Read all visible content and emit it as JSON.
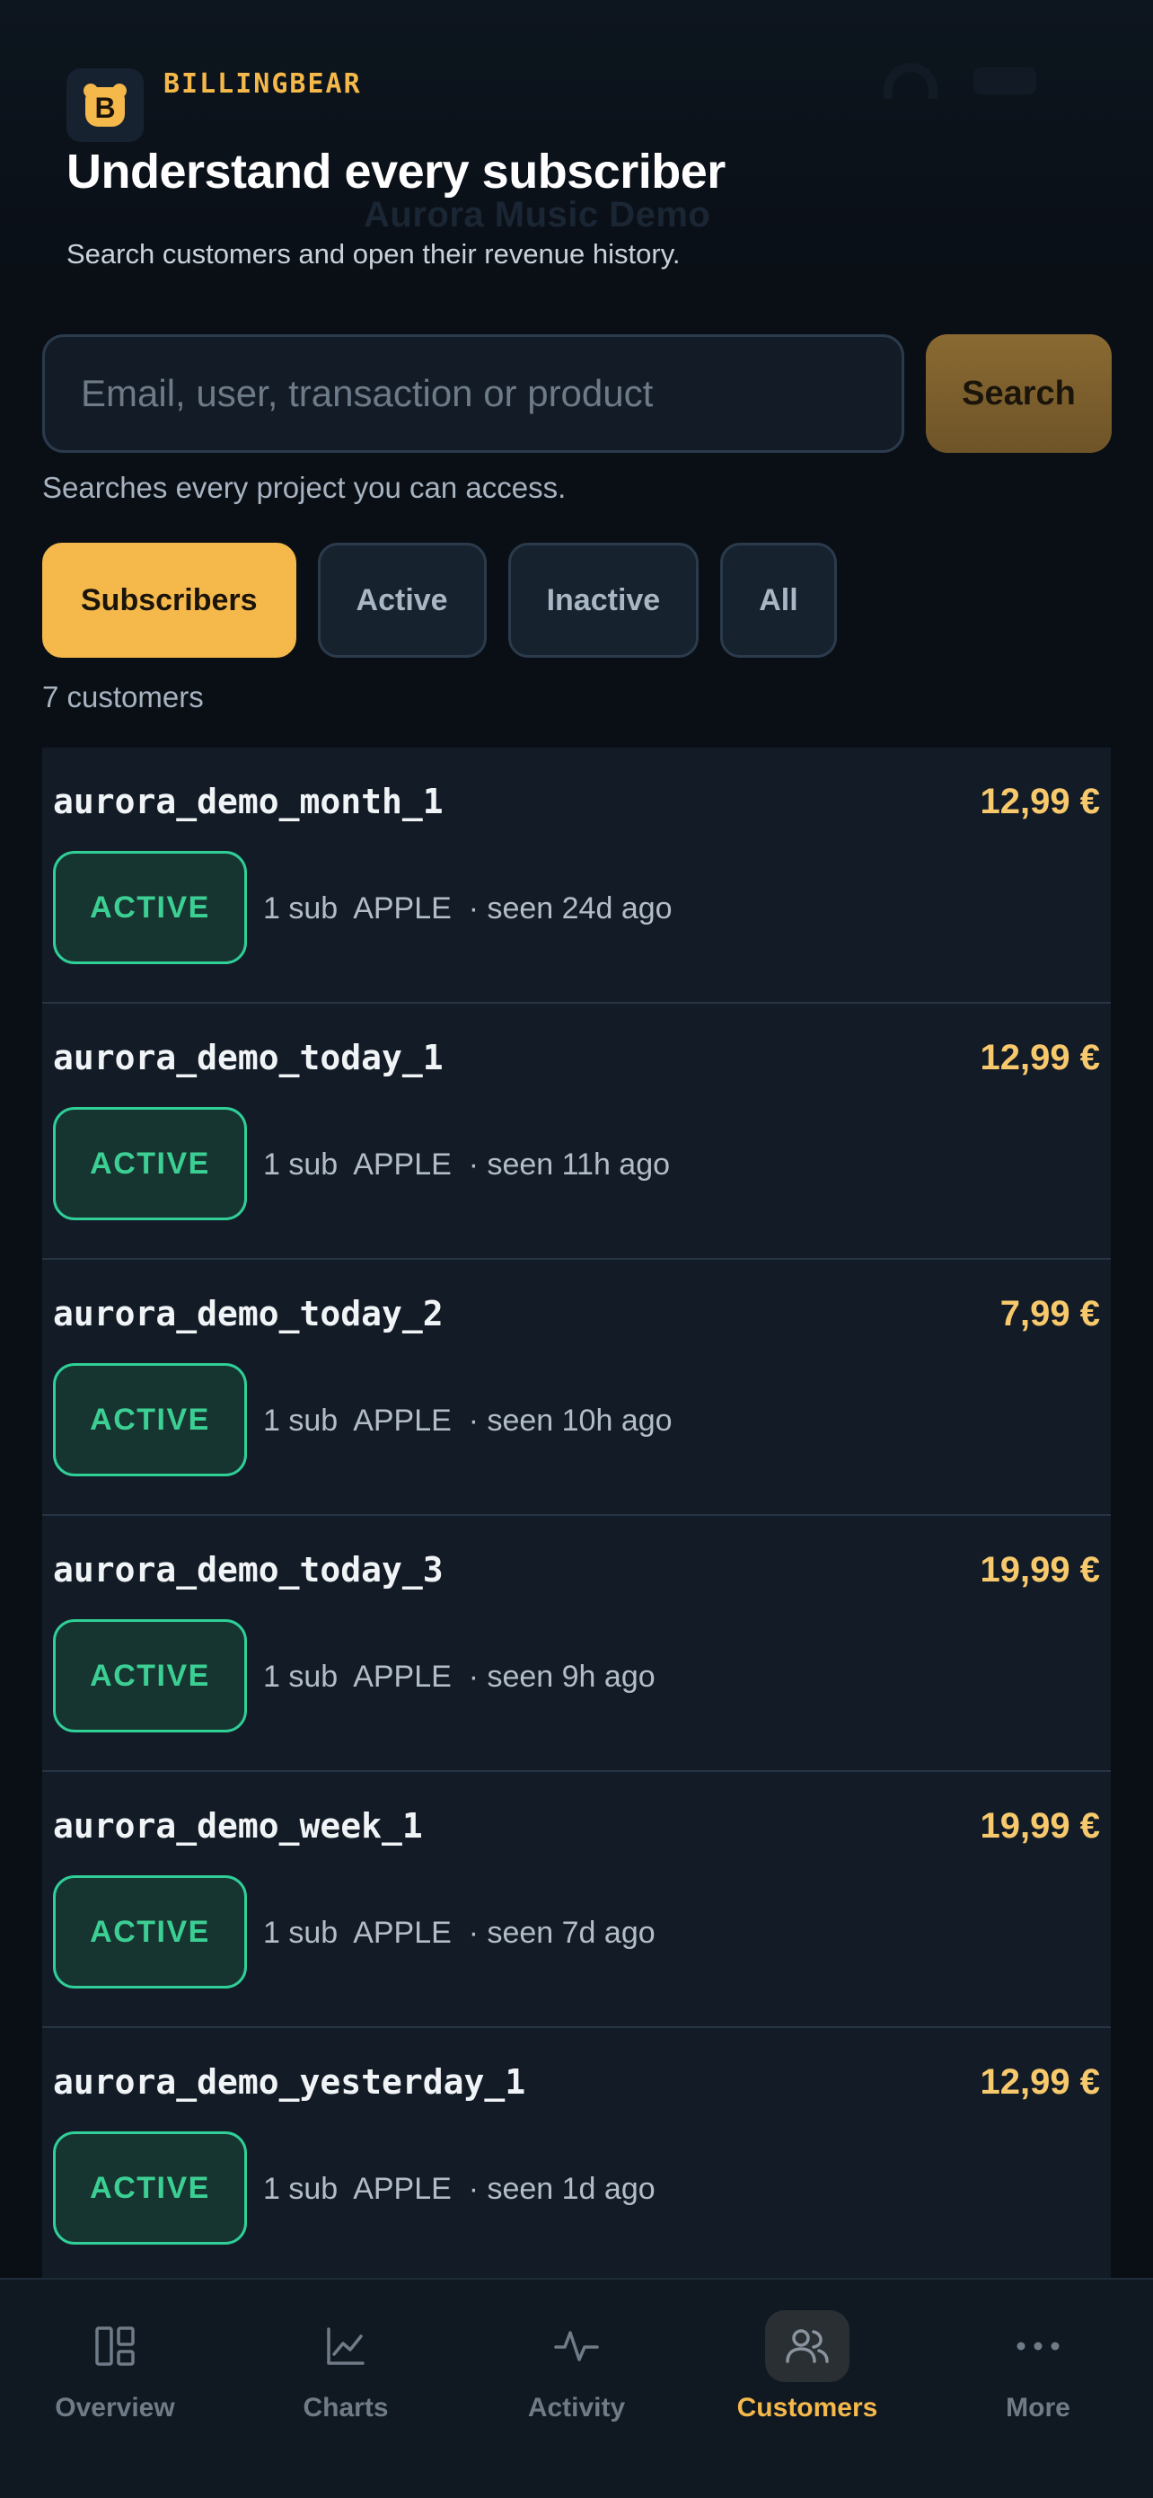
{
  "app": {
    "brand": "BILLINGBEAR",
    "faint_project": "Aurora Music Demo",
    "headline": "Understand every subscriber",
    "subhead": "Search customers and open their revenue history."
  },
  "search": {
    "placeholder": "Email, user, transaction or product",
    "button_label": "Search",
    "hint": "Searches every project you can access."
  },
  "filters": [
    {
      "label": "Subscribers",
      "active": true
    },
    {
      "label": "Active",
      "active": false
    },
    {
      "label": "Inactive",
      "active": false
    },
    {
      "label": "All",
      "active": false
    }
  ],
  "customers_count": "7 customers",
  "customers": [
    {
      "name": "aurora_demo_month_1",
      "price": "12,99 €",
      "status": "ACTIVE",
      "meta": "1 sub  APPLE  · seen 24d ago"
    },
    {
      "name": "aurora_demo_today_1",
      "price": "12,99 €",
      "status": "ACTIVE",
      "meta": "1 sub  APPLE  · seen 11h ago"
    },
    {
      "name": "aurora_demo_today_2",
      "price": "7,99 €",
      "status": "ACTIVE",
      "meta": "1 sub  APPLE  · seen 10h ago"
    },
    {
      "name": "aurora_demo_today_3",
      "price": "19,99 €",
      "status": "ACTIVE",
      "meta": "1 sub  APPLE  · seen 9h ago"
    },
    {
      "name": "aurora_demo_week_1",
      "price": "19,99 €",
      "status": "ACTIVE",
      "meta": "1 sub  APPLE  · seen 7d ago"
    },
    {
      "name": "aurora_demo_yesterday_1",
      "price": "12,99 €",
      "status": "ACTIVE",
      "meta": "1 sub  APPLE  · seen 1d ago"
    }
  ],
  "tabs": [
    {
      "label": "Overview",
      "icon": "overview-icon",
      "active": false
    },
    {
      "label": "Charts",
      "icon": "charts-icon",
      "active": false
    },
    {
      "label": "Activity",
      "icon": "activity-icon",
      "active": false
    },
    {
      "label": "Customers",
      "icon": "customers-icon",
      "active": true
    },
    {
      "label": "More",
      "icon": "more-icon",
      "active": false
    }
  ],
  "colors": {
    "accent": "#f4b84b",
    "active_green": "#3ccf93",
    "background": "#0a0f16"
  }
}
